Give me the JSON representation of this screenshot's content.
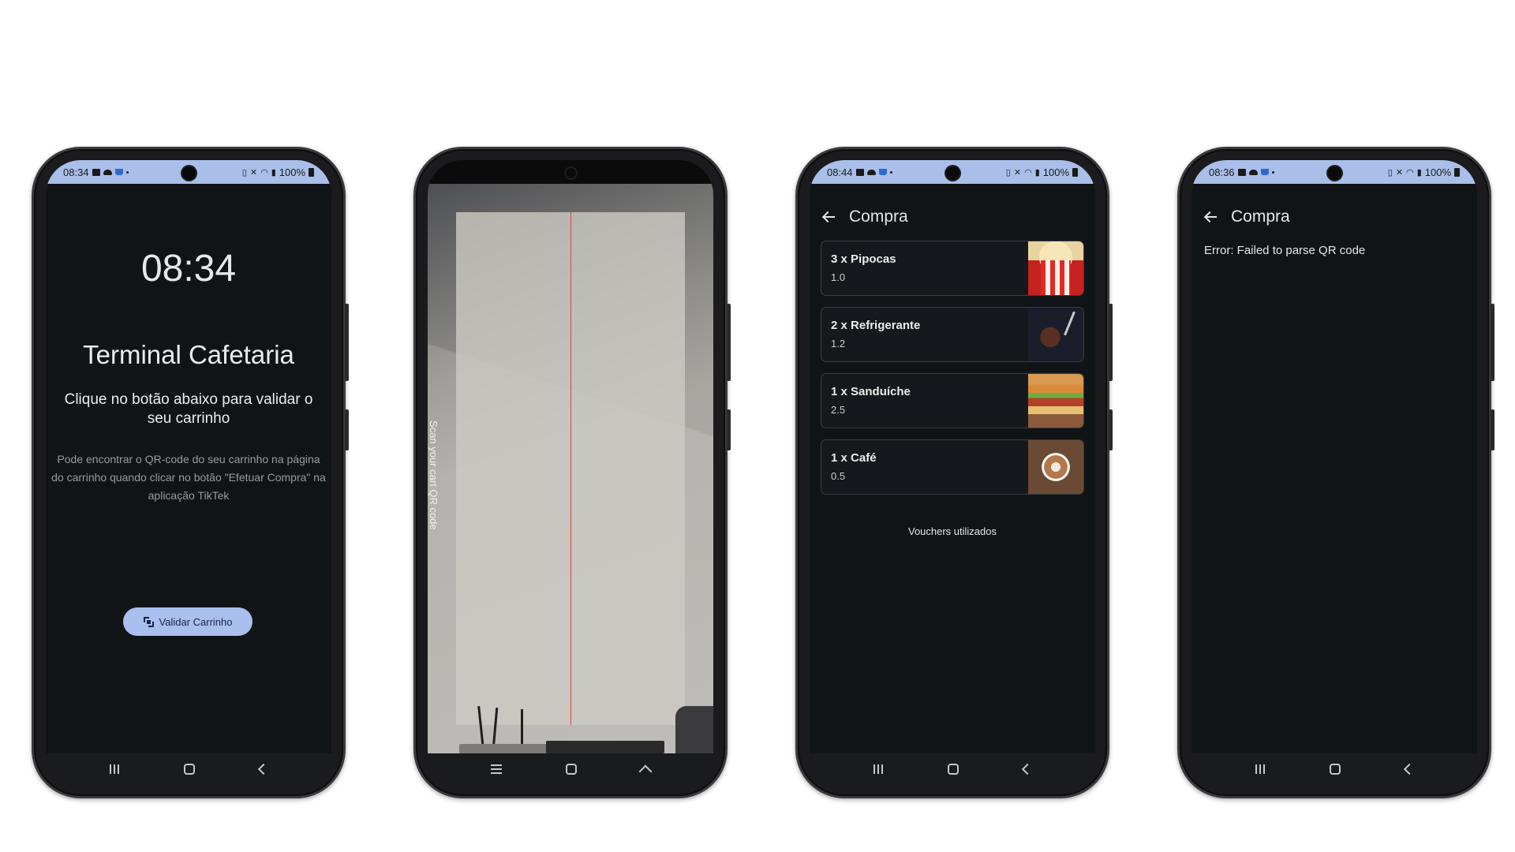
{
  "phones": {
    "p1": {
      "status": {
        "time": "08:34",
        "battery": "100%"
      },
      "time": "08:34",
      "title": "Terminal Cafetaria",
      "subtitle": "Clique no botão abaixo para validar o seu carrinho",
      "note": "Pode encontrar o QR-code do seu carrinho na página do carrinho quando clicar no botão \"Efetuar Compra\" na aplicação TikTek",
      "button_label": "Validar Carrinho"
    },
    "p2": {
      "scan_label": "Scan your cart QR code"
    },
    "p3": {
      "status": {
        "time": "08:44",
        "battery": "100%"
      },
      "title": "Compra",
      "items": [
        {
          "name": "3 x Pipocas",
          "price": "1.0",
          "thumb": "popcorn"
        },
        {
          "name": "2 x Refrigerante",
          "price": "1.2",
          "thumb": "soda"
        },
        {
          "name": "1 x Sanduíche",
          "price": "2.5",
          "thumb": "sandwich"
        },
        {
          "name": "1 x Café",
          "price": "0.5",
          "thumb": "coffee"
        }
      ],
      "vouchers_label": "Vouchers utilizados"
    },
    "p4": {
      "status": {
        "time": "08:36",
        "battery": "100%"
      },
      "title": "Compra",
      "error": "Error: Failed to parse QR code"
    }
  },
  "colors": {
    "statusbar": "#a9bfe9",
    "screen_bg": "#111417",
    "button_bg": "#a9bfee",
    "scan_line": "#d44848"
  },
  "icons": [
    "back-arrow-icon",
    "qr-scan-icon",
    "nav-recent-icon",
    "nav-home-icon",
    "nav-back-icon"
  ]
}
